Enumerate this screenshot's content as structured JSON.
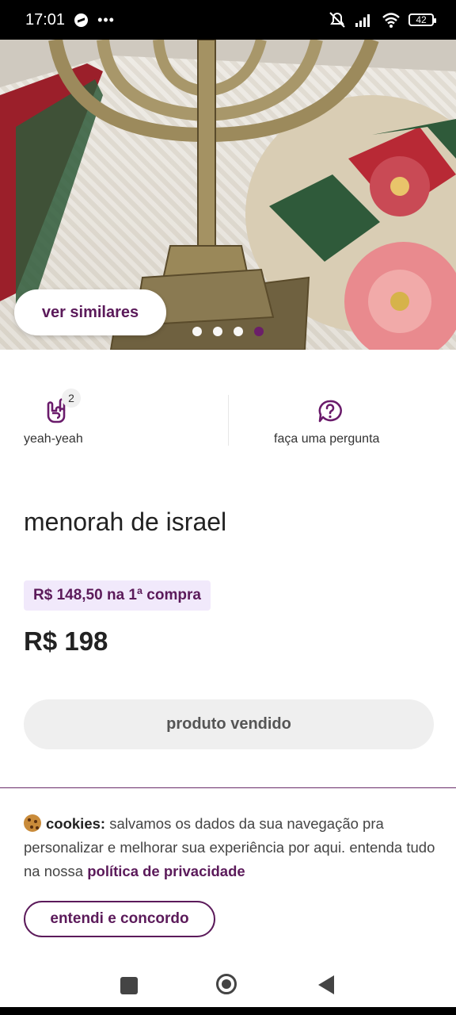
{
  "status_bar": {
    "time": "17:01",
    "battery": "42"
  },
  "hero": {
    "similar_button": "ver similares",
    "carousel": {
      "count": 4,
      "active_index": 3
    }
  },
  "actions": {
    "like": {
      "label": "yeah-yeah",
      "count": "2"
    },
    "question": {
      "label": "faça uma pergunta"
    }
  },
  "product": {
    "title": "menorah de israel",
    "promo": "R$ 148,50 na 1ª compra",
    "price": "R$ 198",
    "sold_button": "produto vendido"
  },
  "cookie_banner": {
    "label": "cookies:",
    "text": " salvamos os dados da sua navegação pra personalizar e melhorar sua experiência por aqui. entenda tudo na nossa ",
    "link": "política de privacidade",
    "agree_button": "entendi e concordo"
  },
  "colors": {
    "brand": "#5b1a5a",
    "promo_bg": "#f1e9fb"
  }
}
